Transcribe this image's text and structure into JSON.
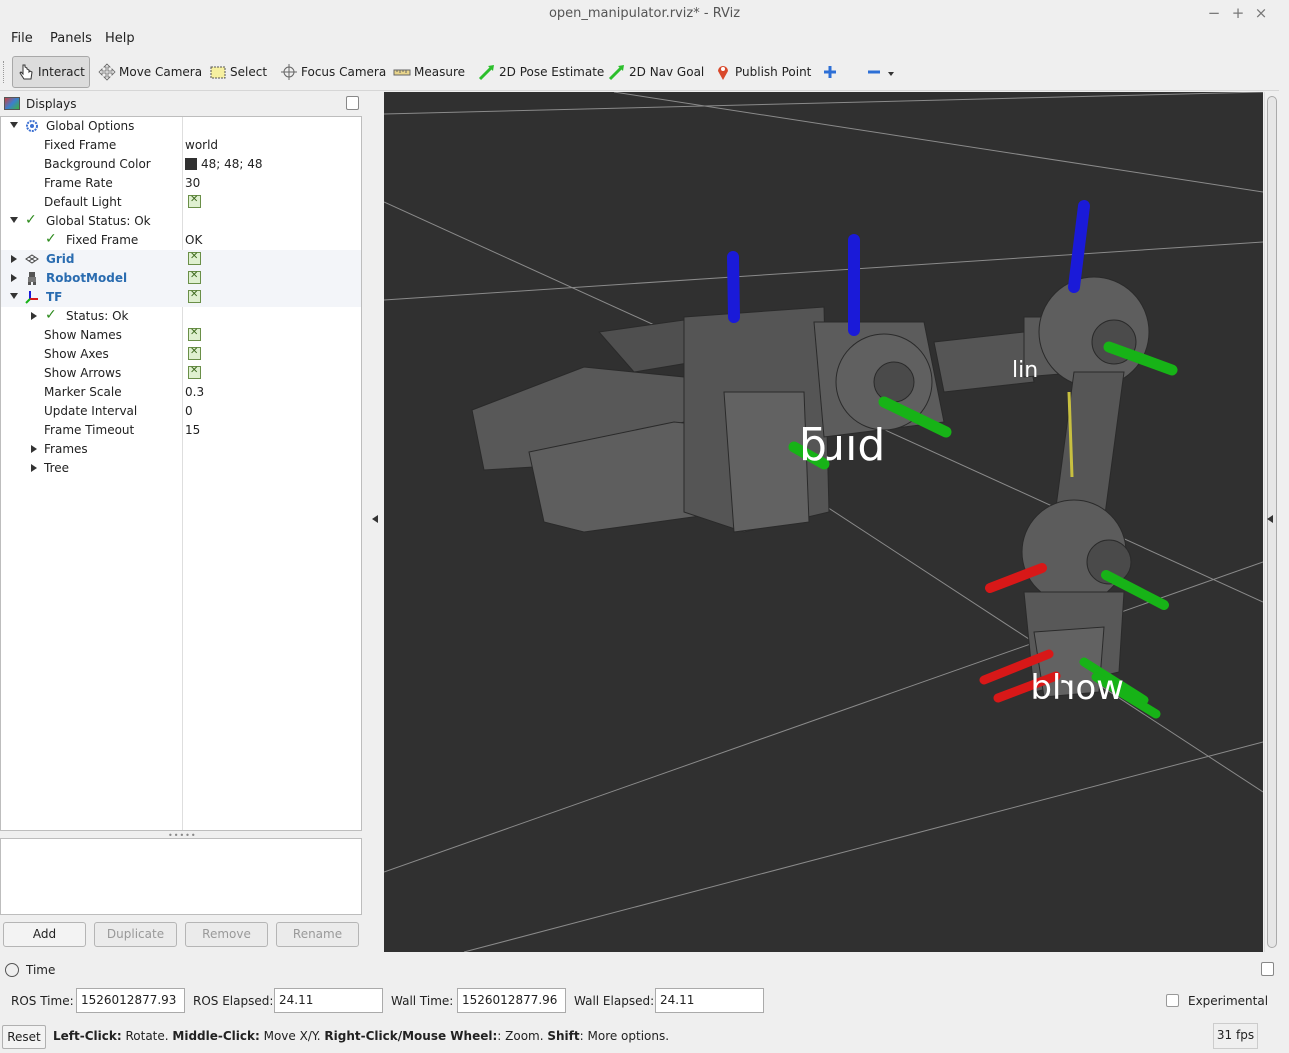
{
  "window": {
    "title": "open_manipulator.rviz* - RViz",
    "minimize": "−",
    "maximize": "+",
    "close": "×"
  },
  "menu": {
    "file": "File",
    "panels": "Panels",
    "help": "Help"
  },
  "toolbar": {
    "interact": "Interact",
    "move_camera": "Move Camera",
    "select": "Select",
    "focus_camera": "Focus Camera",
    "measure": "Measure",
    "pose_estimate": "2D Pose Estimate",
    "nav_goal": "2D Nav Goal",
    "publish_point": "Publish Point"
  },
  "displays": {
    "title": "Displays",
    "global_options": "Global Options",
    "fixed_frame_label": "Fixed Frame",
    "fixed_frame_value": "world",
    "bg_color_label": "Background Color",
    "bg_color_value": "48; 48; 48",
    "bg_color_hex": "#303030",
    "frame_rate_label": "Frame Rate",
    "frame_rate_value": "30",
    "default_light_label": "Default Light",
    "global_status": "Global Status: Ok",
    "status_fixed_frame_label": "Fixed Frame",
    "status_fixed_frame_value": "OK",
    "grid": "Grid",
    "robot_model": "RobotModel",
    "tf": "TF",
    "tf_status": "Status: Ok",
    "show_names": "Show Names",
    "show_axes": "Show Axes",
    "show_arrows": "Show Arrows",
    "marker_scale_label": "Marker Scale",
    "marker_scale_value": "0.3",
    "update_interval_label": "Update Interval",
    "update_interval_value": "0",
    "frame_timeout_label": "Frame Timeout",
    "frame_timeout_value": "15",
    "frames": "Frames",
    "tree": "Tree"
  },
  "buttons": {
    "add": "Add",
    "duplicate": "Duplicate",
    "remove": "Remove",
    "rename": "Rename"
  },
  "viewport": {
    "label_link": "ƃɹıd",
    "label_world": "world",
    "label_link2": "lin"
  },
  "time": {
    "title": "Time",
    "ros_time_label": "ROS Time:",
    "ros_time_value": "1526012877.93",
    "ros_elapsed_label": "ROS Elapsed:",
    "ros_elapsed_value": "24.11",
    "wall_time_label": "Wall Time:",
    "wall_time_value": "1526012877.96",
    "wall_elapsed_label": "Wall Elapsed:",
    "wall_elapsed_value": "24.11",
    "experimental": "Experimental"
  },
  "status": {
    "reset": "Reset",
    "lc": "Left-Click:",
    "lc_t": " Rotate. ",
    "mc": "Middle-Click:",
    "mc_t": " Move X/Y. ",
    "rc": "Right-Click/Mouse Wheel:",
    "rc_t": ": Zoom. ",
    "sh": "Shift",
    "sh_t": ": More options.",
    "fps": "31 fps"
  },
  "colors": {
    "viewport_bg": "#303030",
    "link_blue": "#2a6cb0",
    "axis_red": "#d81818",
    "axis_green": "#17b317",
    "axis_blue": "#1a1ad8"
  }
}
